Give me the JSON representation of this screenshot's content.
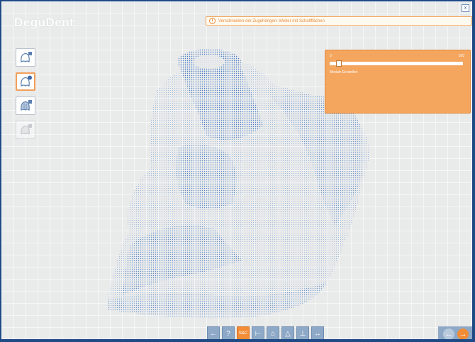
{
  "app": {
    "logo": "DeguDent"
  },
  "hint": {
    "text": "Verschneiden der Zugehörigen: Weiter mit Schaltflächen",
    "icon": "info-icon"
  },
  "window": {
    "close_label": "x",
    "close_icon": "close-icon"
  },
  "tools": [
    {
      "name": "tooth-view-tool",
      "icon": "tooth-icon",
      "active": false
    },
    {
      "name": "tooth-edit-tool",
      "icon": "tooth-plus-icon",
      "active": true
    },
    {
      "name": "tooth-mesh-tool",
      "icon": "tooth-mesh-icon",
      "active": false
    },
    {
      "name": "tooth-disabled-tool",
      "icon": "tooth-grey-icon",
      "active": false
    }
  ],
  "panel": {
    "min_label": "0",
    "max_label": "100",
    "slider_value": 0.05,
    "caption": "Moduln Einstellen"
  },
  "bottom_toolbar": {
    "buttons": [
      {
        "name": "back-small-button",
        "label": "←",
        "icon": "arrow-left-icon"
      },
      {
        "name": "help-button",
        "label": "?",
        "icon": "help-icon"
      },
      {
        "name": "cut-button",
        "label": "S&C",
        "icon": "cut-icon"
      },
      {
        "name": "measure-button",
        "label": "⊢",
        "icon": "measure-icon"
      },
      {
        "name": "view-front-button",
        "label": "⌂",
        "icon": "view-front-icon"
      },
      {
        "name": "view-side-button",
        "label": "△",
        "icon": "view-side-icon"
      },
      {
        "name": "view-top-button",
        "label": "⊥",
        "icon": "view-top-icon"
      },
      {
        "name": "ruler-button",
        "label": "↔",
        "icon": "ruler-icon"
      }
    ]
  },
  "navigation": {
    "back_label": "←",
    "forward_label": "→"
  },
  "colors": {
    "accent": "#f28c36",
    "model_blue": "#4b7fc6",
    "frame": "#1e4a86"
  }
}
